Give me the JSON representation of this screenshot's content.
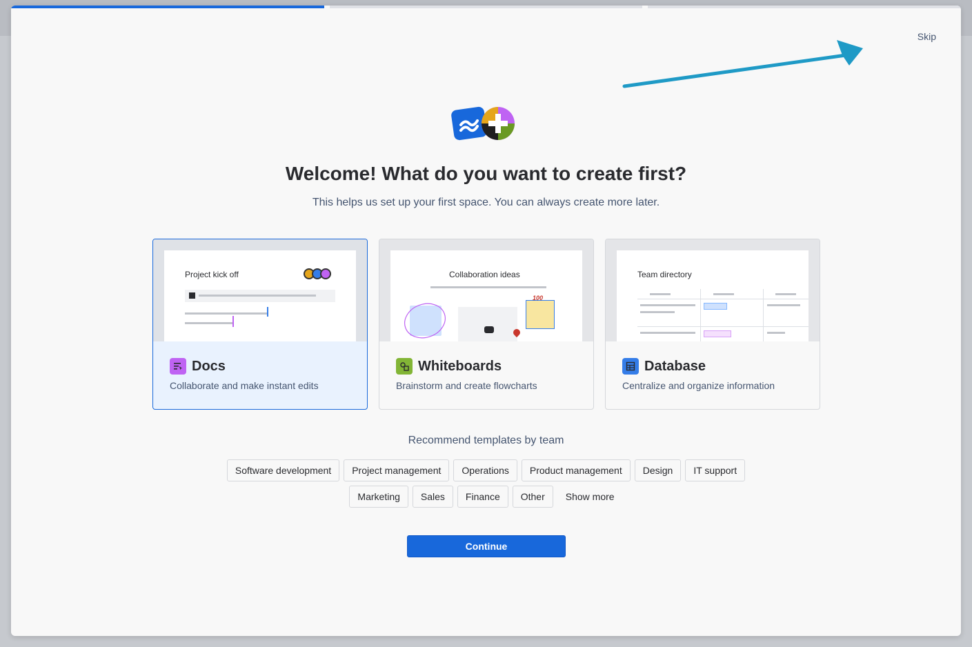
{
  "progress": {
    "steps": 3,
    "current": 1
  },
  "header": {
    "skip_label": "Skip"
  },
  "main": {
    "title": "Welcome! What do you want to create first?",
    "subtitle": "This helps us set up your first space. You can always create more later."
  },
  "cards": [
    {
      "title": "Docs",
      "description": "Collaborate and make instant edits",
      "preview_title": "Project kick off",
      "icon": "docs-icon",
      "icon_color": "#bf63f3",
      "selected": true
    },
    {
      "title": "Whiteboards",
      "description": "Brainstorm and create flowcharts",
      "preview_title": "Collaboration ideas",
      "icon": "whiteboards-icon",
      "icon_color": "#82b536",
      "selected": false
    },
    {
      "title": "Database",
      "description": "Centralize and organize information",
      "preview_title": "Team directory",
      "icon": "database-icon",
      "icon_color": "#357de8",
      "selected": false
    }
  ],
  "whiteboard_sticker": "100",
  "recommend": {
    "label": "Recommend templates by team",
    "chips_row1": [
      "Software development",
      "Project management",
      "Operations",
      "Product management",
      "Design",
      "IT support"
    ],
    "chips_row2": [
      "Marketing",
      "Sales",
      "Finance",
      "Other"
    ],
    "show_more": "Show more"
  },
  "footer": {
    "continue_label": "Continue"
  },
  "colors": {
    "accent": "#1868db",
    "arrow": "#1f9ac6"
  }
}
